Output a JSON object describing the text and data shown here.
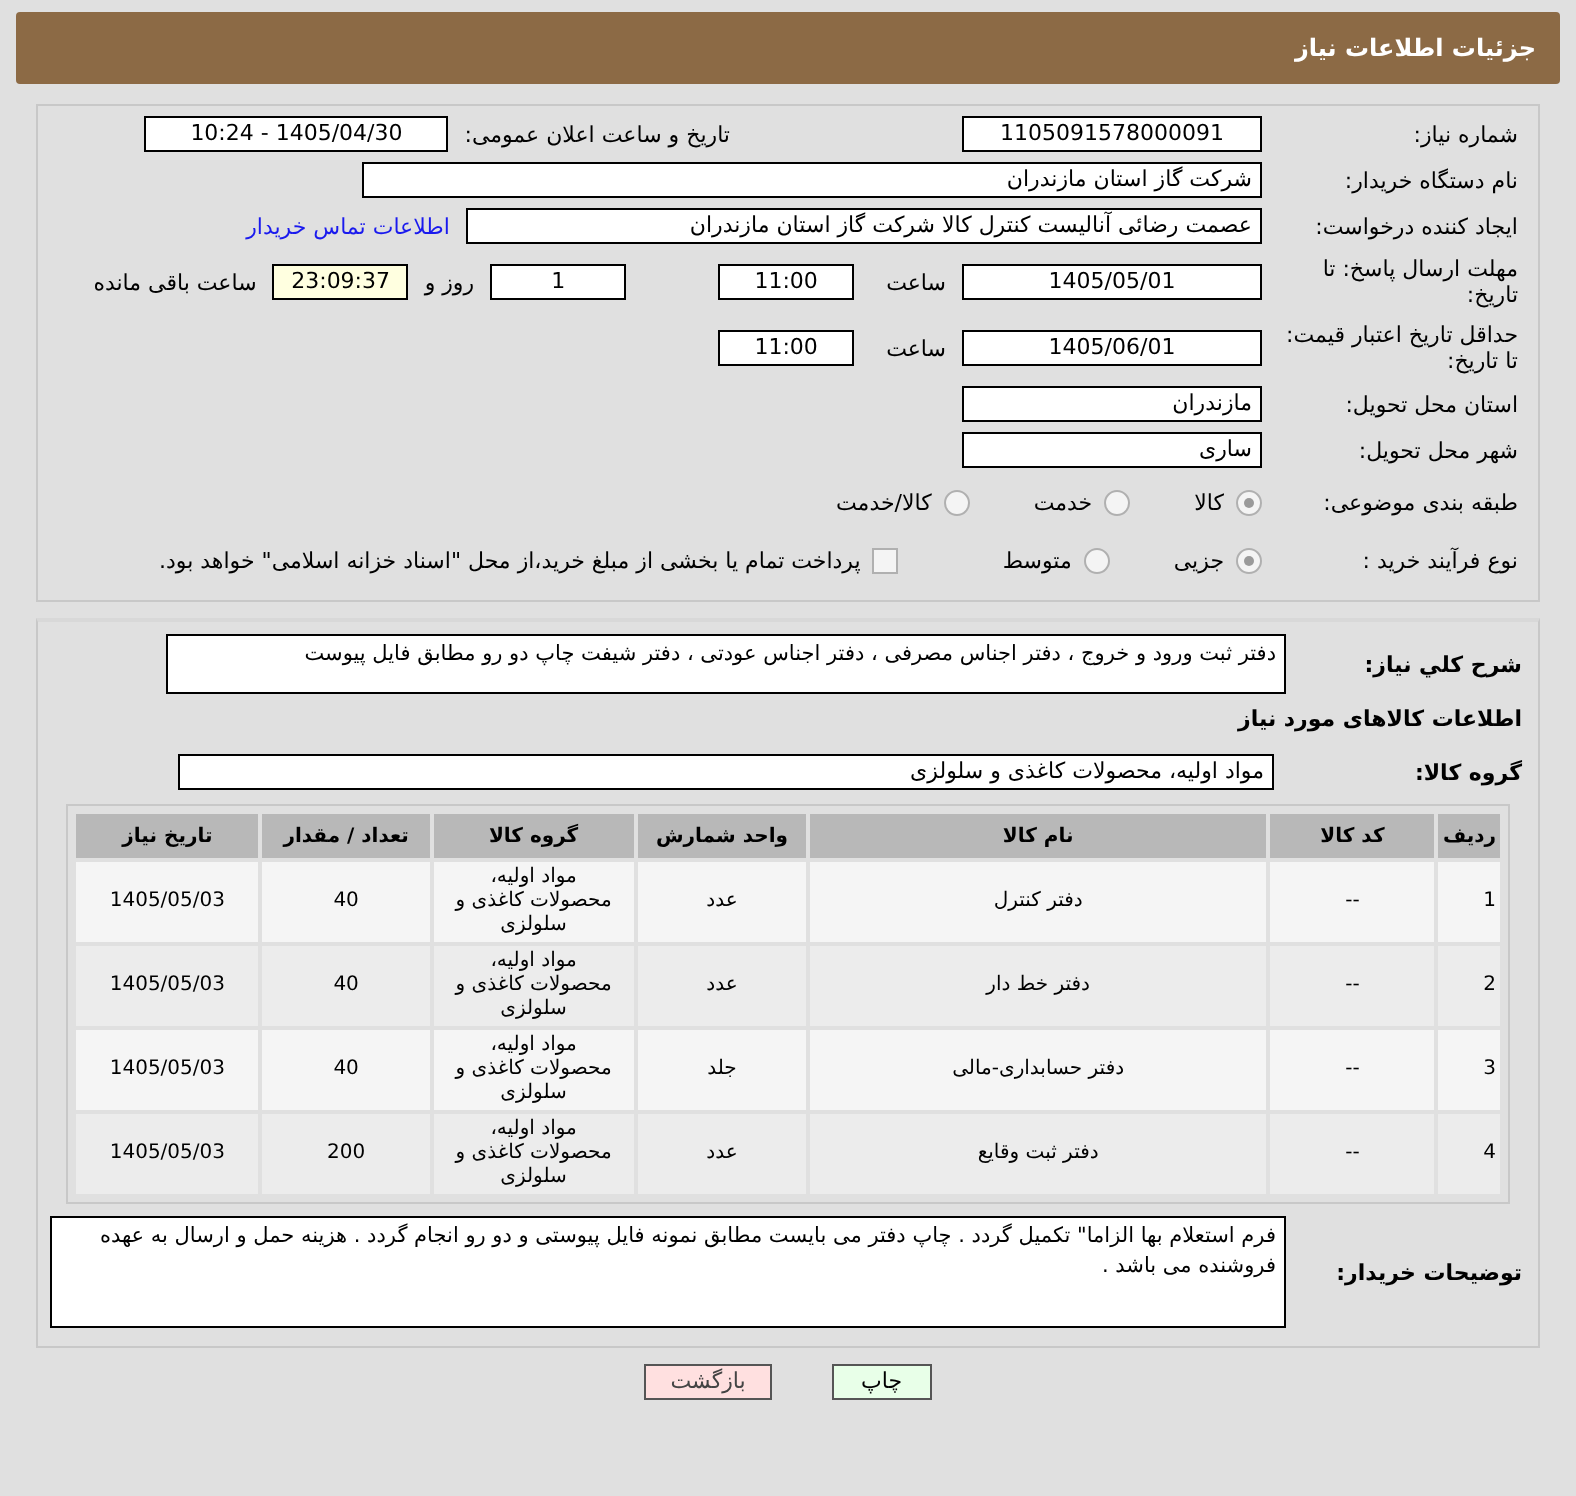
{
  "header": {
    "title": "جزئیات اطلاعات نیاز"
  },
  "need_number": {
    "label": "شماره نیاز:",
    "value": "1105091578000091"
  },
  "announce": {
    "label": "تاریخ و ساعت اعلان عمومی:",
    "value": "1405/04/30 - 10:24"
  },
  "buyer_org": {
    "label": "نام دستگاه خریدار:",
    "value": "شرکت گاز استان مازندران"
  },
  "requester": {
    "label": "ایجاد کننده درخواست:",
    "value": "عصمت رضائی آنالیست کنترل کالا شرکت گاز استان مازندران",
    "link": "اطلاعات تماس خریدار"
  },
  "reply_deadline": {
    "label": "مهلت ارسال پاسخ: تا تاریخ:",
    "date": "1405/05/01",
    "time_label": "ساعت",
    "time": "11:00",
    "days": "1",
    "days_label": "روز و",
    "remaining": "23:09:37",
    "remaining_label": "ساعت باقی مانده"
  },
  "price_validity": {
    "label": "حداقل تاریخ اعتبار قیمت: تا تاریخ:",
    "date": "1405/06/01",
    "time_label": "ساعت",
    "time": "11:00"
  },
  "province": {
    "label": "استان محل تحویل:",
    "value": "مازندران"
  },
  "city": {
    "label": "شهر محل تحویل:",
    "value": "ساری"
  },
  "category": {
    "label": "طبقه بندی موضوعی:",
    "options": [
      {
        "label": "کالا",
        "selected": true
      },
      {
        "label": "خدمت",
        "selected": false
      },
      {
        "label": "کالا/خدمت",
        "selected": false
      }
    ]
  },
  "process": {
    "label": "نوع فرآیند خرید :",
    "options": [
      {
        "label": "جزیی",
        "selected": true
      },
      {
        "label": "متوسط",
        "selected": false
      }
    ],
    "treasury": {
      "checked": false,
      "label": "پرداخت تمام یا بخشی از مبلغ خرید،از محل \"اسناد خزانه اسلامی\" خواهد بود."
    }
  },
  "description": {
    "label": "شرح کلي نياز:",
    "value": "دفتر ثبت ورود و خروج ، دفتر اجناس مصرفی ، دفتر اجناس عودتی ، دفتر شیفت چاپ دو رو مطابق فایل پیوست"
  },
  "goods_heading": "اطلاعات کالاهای مورد نیاز",
  "goods_group": {
    "label": "گروه کالا:",
    "value": "مواد اولیه، محصولات کاغذی و سلولزی"
  },
  "table": {
    "columns": [
      "ردیف",
      "کد کالا",
      "نام کالا",
      "واحد شمارش",
      "گروه کالا",
      "تعداد / مقدار",
      "تاریخ نیاز"
    ],
    "rows": [
      [
        "1",
        "--",
        "دفتر کنترل",
        "عدد",
        "مواد اولیه، محصولات کاغذی و سلولزی",
        "40",
        "1405/05/03"
      ],
      [
        "2",
        "--",
        "دفتر خط دار",
        "عدد",
        "مواد اولیه، محصولات کاغذی و سلولزی",
        "40",
        "1405/05/03"
      ],
      [
        "3",
        "--",
        "دفتر حسابداری-مالی",
        "جلد",
        "مواد اولیه، محصولات کاغذی و سلولزی",
        "40",
        "1405/05/03"
      ],
      [
        "4",
        "--",
        "دفتر ثبت وقایع",
        "عدد",
        "مواد اولیه، محصولات کاغذی و سلولزی",
        "200",
        "1405/05/03"
      ]
    ]
  },
  "buyer_notes": {
    "label": "توضیحات خریدار:",
    "value": "فرم استعلام بها الزاما\" تکمیل گردد . چاپ دفتر می بایست مطابق نمونه فایل پیوستی و دو رو انجام گردد . هزینه حمل و ارسال به عهده فروشنده می باشد ."
  },
  "buttons": [
    {
      "kind": "print",
      "label": "چاپ"
    },
    {
      "kind": "back",
      "label": "بازگشت"
    }
  ]
}
